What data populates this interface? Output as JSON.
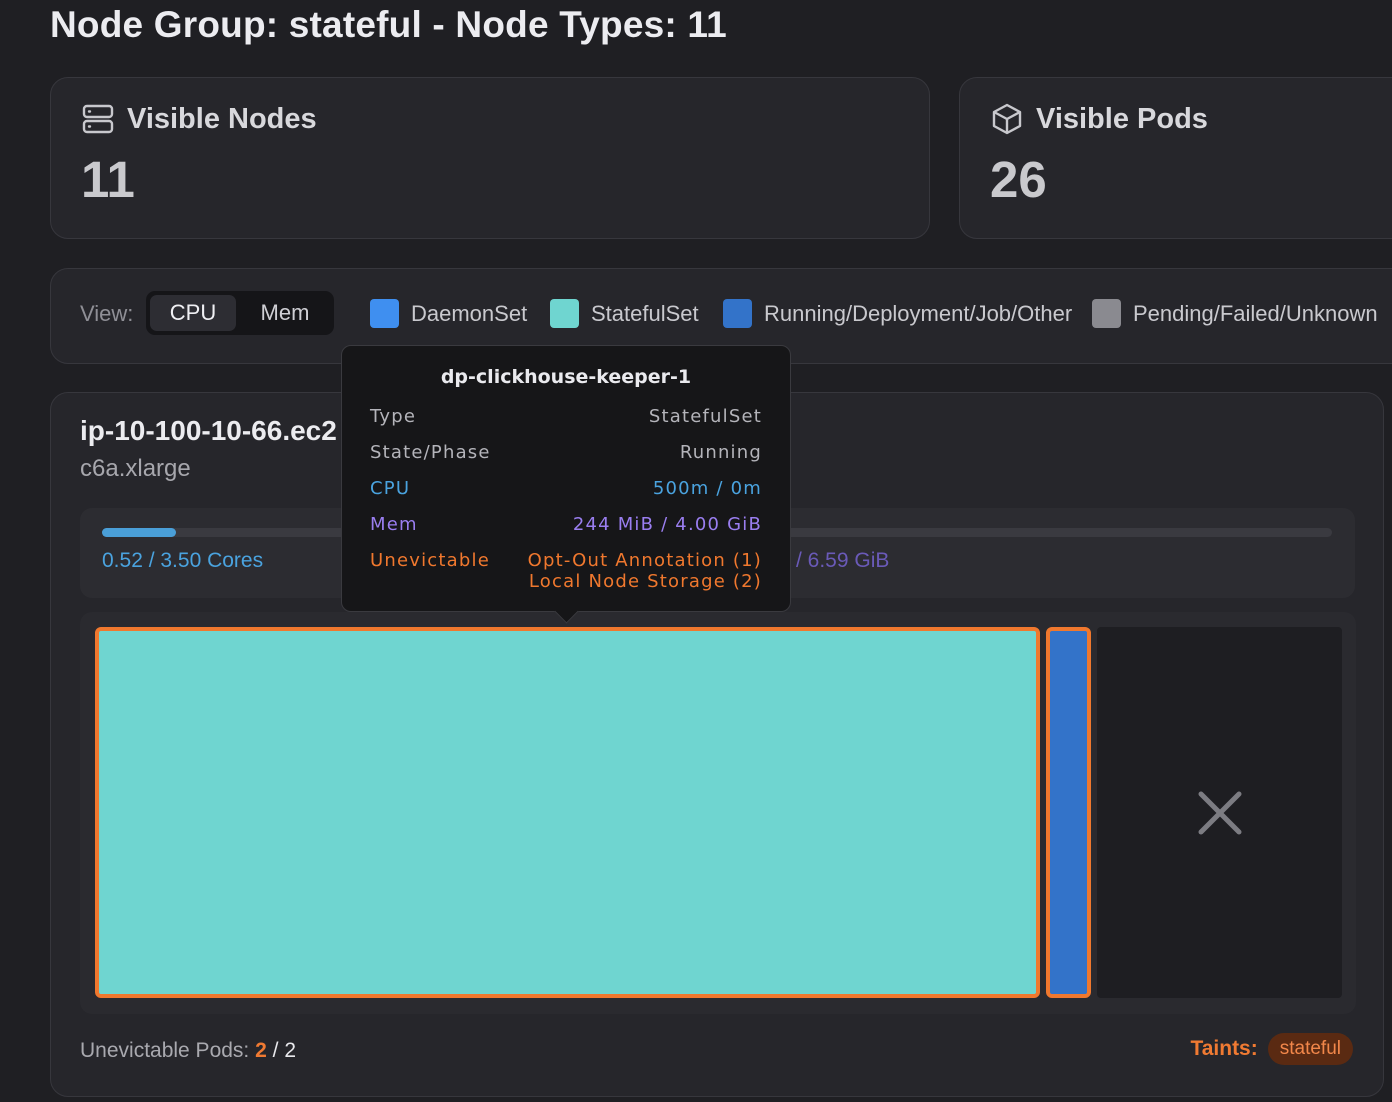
{
  "header": {
    "title": "Node Group: stateful - Node Types: 11"
  },
  "stats": {
    "nodes": {
      "label": "Visible Nodes",
      "value": "11",
      "icon": "server-icon"
    },
    "pods": {
      "label": "Visible Pods",
      "value": "26",
      "icon": "cube-icon"
    }
  },
  "legend": {
    "view_label": "View:",
    "view_options": [
      "CPU",
      "Mem"
    ],
    "selected_view": "CPU",
    "items": [
      {
        "label": "DaemonSet",
        "color": "#3f8ff0"
      },
      {
        "label": "StatefulSet",
        "color": "#6fd5d0"
      },
      {
        "label": "Running/Deployment/Job/Other",
        "color": "#3373c9"
      },
      {
        "label": "Pending/Failed/Unknown",
        "color": "#8a8a90"
      }
    ]
  },
  "node": {
    "name": "ip-10-100-10-66.ec2",
    "instance_type": "c6a.xlarge",
    "cpu": {
      "label": "0.52 / 3.50 Cores",
      "used": 0.52,
      "total": 3.5,
      "color": "#4a9fd8"
    },
    "mem": {
      "label": "/ 6.59 GiB",
      "fill_fraction": 0.05,
      "color": "#7a60c8"
    },
    "pods": [
      {
        "name": "dp-clickhouse-keeper-1",
        "type": "StatefulSet",
        "color": "#6fd5d0",
        "unevictable": true
      },
      {
        "name": "",
        "type": "Running",
        "color": "#3373c9",
        "unevictable": true
      }
    ],
    "free_icon": "close-icon",
    "unevictable": {
      "label": "Unevictable Pods:",
      "count": "2",
      "total": "2"
    },
    "taints": {
      "label": "Taints:",
      "items": [
        "stateful"
      ]
    }
  },
  "tooltip": {
    "title": "dp-clickhouse-keeper-1",
    "rows": [
      {
        "key": "Type",
        "value": "StatefulSet",
        "color": "#b4b4ba"
      },
      {
        "key": "State/Phase",
        "value": "Running",
        "color": "#b4b4ba"
      },
      {
        "key": "CPU",
        "value": "500m / 0m",
        "color": "#4aa3df"
      },
      {
        "key": "Mem",
        "value": "244 MiB / 4.00 GiB",
        "color": "#9a7ef0"
      },
      {
        "key": "Unevictable",
        "value": "Opt-Out Annotation (1)",
        "value2": "Local Node Storage (2)",
        "color": "#f0782e"
      }
    ]
  }
}
